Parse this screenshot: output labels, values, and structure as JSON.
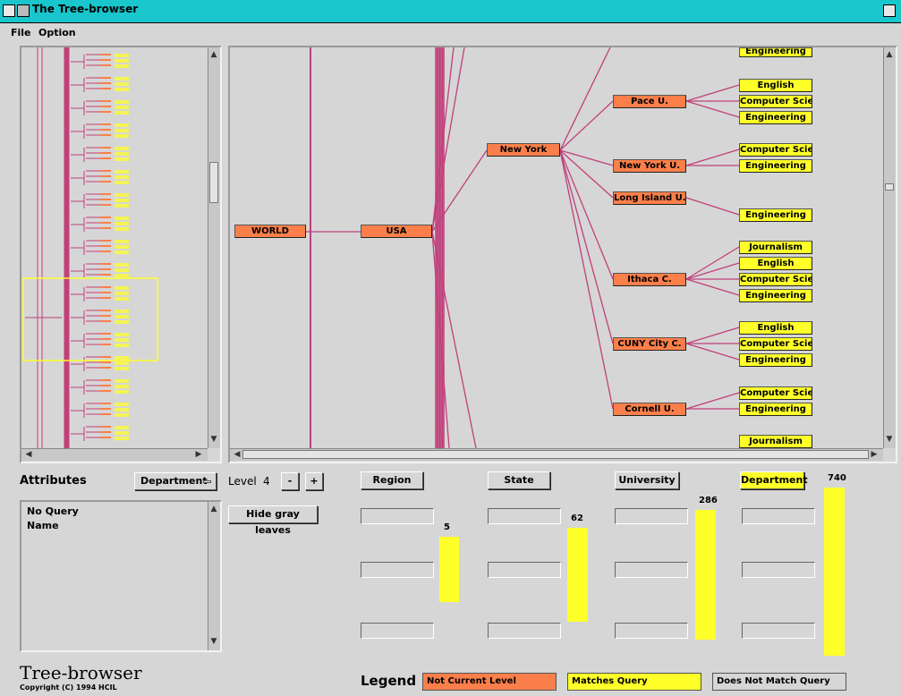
{
  "window": {
    "title": "The Tree-browser"
  },
  "menu": {
    "file": "File",
    "option": "Option"
  },
  "tree": {
    "world": "WORLD",
    "usa": "USA",
    "new_york": "New York",
    "universities": [
      "Pace U.",
      "New York U.",
      "Long Island U.",
      "Ithaca C.",
      "CUNY City C.",
      "Cornell U."
    ],
    "departments": {
      "top": "Engineering",
      "pace": [
        "English",
        "Computer Scien",
        "Engineering"
      ],
      "nyu": [
        "Computer Scien",
        "Engineering"
      ],
      "liu": [
        "Engineering"
      ],
      "ithaca": [
        "Journalism",
        "English",
        "Computer Scien",
        "Engineering"
      ],
      "cuny": [
        "English",
        "Computer Scien",
        "Engineering"
      ],
      "cornell": [
        "Computer Scien",
        "Engineering"
      ],
      "bottom": "Journalism"
    }
  },
  "controls": {
    "attributes_label": "Attributes",
    "attribute_select": "Department",
    "level_label": "Level",
    "level_value": "4",
    "minus": "-",
    "plus": "+",
    "hide_gray": "Hide gray leaves",
    "query_list": [
      "No Query",
      "Name"
    ]
  },
  "levels": {
    "region": {
      "label": "Region",
      "count": "5",
      "fill": 0.39
    },
    "state": {
      "label": "State",
      "count": "62",
      "fill": 0.56
    },
    "university": {
      "label": "University",
      "count": "286",
      "fill": 0.77
    },
    "department": {
      "label": "Department",
      "count": "740",
      "fill": 1.0
    }
  },
  "branding": {
    "name": "Tree-browser",
    "copyright": "Copyright (C) 1994 HCIL"
  },
  "legend": {
    "title": "Legend",
    "not_current": "Not Current Level",
    "matches": "Matches Query",
    "no_match": "Does Not Match Query"
  },
  "colors": {
    "node_orange": "#fb7f4a",
    "match_yellow": "#ffff2a",
    "edge": "#c0407a",
    "titlebar": "#18c6cc"
  }
}
